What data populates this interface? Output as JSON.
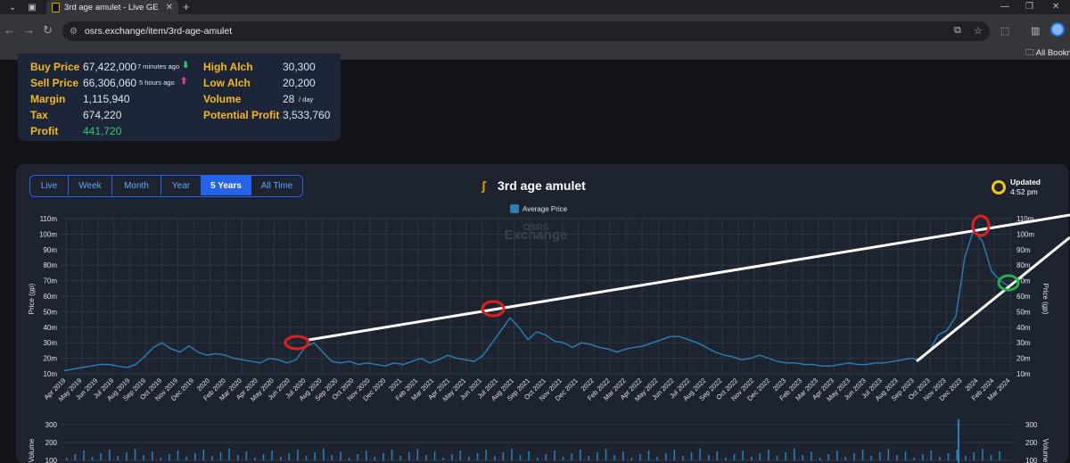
{
  "browser": {
    "tab_title": "3rd age amulet - Live GE Price C",
    "url": "osrs.exchange/item/3rd-age-amulet",
    "bookmarks_label": "All Bookm"
  },
  "stats": {
    "buy_price_label": "Buy Price",
    "buy_price": "67,422,000",
    "buy_time": "7 minutes ago",
    "sell_price_label": "Sell Price",
    "sell_price": "66,306,060",
    "sell_time": "5 hours ago",
    "margin_label": "Margin",
    "margin": "1,115,940",
    "tax_label": "Tax",
    "tax": "674,220",
    "profit_label": "Profit",
    "profit": "441,720",
    "high_alch_label": "High Alch",
    "high_alch": "30,300",
    "low_alch_label": "Low Alch",
    "low_alch": "20,200",
    "volume_label": "Volume",
    "volume": "28",
    "volume_unit": "/ day",
    "potential_profit_label": "Potential Profit",
    "potential_profit": "3,533,760"
  },
  "ranges": [
    {
      "label": "Live",
      "active": false
    },
    {
      "label": "Week",
      "active": false
    },
    {
      "label": "Month",
      "active": false
    },
    {
      "label": "Year",
      "active": false
    },
    {
      "label": "5 Years",
      "active": true
    },
    {
      "label": "All Time",
      "active": false
    }
  ],
  "chart_header": {
    "title": "3rd age amulet",
    "updated_label": "Updated",
    "updated_time": "4:52 pm",
    "watermark_top": "OSRS",
    "watermark_bottom": "Exchange"
  },
  "colors": {
    "line": "#2a7fb8",
    "accent": "#2563eb",
    "gold": "#f5b81b",
    "profit": "#2ecc71",
    "annotation_red": "#e02020",
    "annotation_green": "#22b14c",
    "annotation_line": "#ffffff"
  },
  "chart_data": [
    {
      "type": "line",
      "title": "3rd age amulet",
      "ylabel": "Price (gp)",
      "series": [
        {
          "name": "Average Price",
          "values": [
            12,
            13,
            14,
            15,
            16,
            16,
            15,
            14,
            16,
            21,
            27,
            30,
            26,
            24,
            28,
            24,
            22,
            23,
            22,
            20,
            19,
            18,
            17,
            20,
            19,
            17,
            19,
            27,
            30,
            24,
            18,
            17,
            18,
            16,
            17,
            16,
            15,
            17,
            16,
            18,
            20,
            17,
            19,
            22,
            20,
            19,
            18,
            22,
            30,
            38,
            46,
            40,
            32,
            37,
            35,
            31,
            30,
            27,
            30,
            29,
            27,
            26,
            24,
            26,
            27,
            28,
            30,
            32,
            34,
            34,
            32,
            30,
            27,
            24,
            22,
            21,
            19,
            20,
            22,
            20,
            18,
            17,
            17,
            16,
            16,
            15,
            15,
            16,
            17,
            16,
            16,
            17,
            17,
            18,
            19,
            20,
            19,
            24,
            35,
            38,
            47,
            85,
            103,
            95,
            76,
            70,
            66
          ]
        }
      ],
      "x_tick_labels": [
        "Apr 2019",
        "May 2019",
        "Jun 2019",
        "Jul 2019",
        "Aug 2019",
        "Sep 2019",
        "Oct 2019",
        "Nov 2019",
        "Dec 2019",
        "2020",
        "Feb 2020",
        "Mar 2020",
        "Apr 2020",
        "May 2020",
        "Jun 2020",
        "Jul 2020",
        "Aug 2020",
        "Sep 2020",
        "Oct 2020",
        "Nov 2020",
        "Dec 2020",
        "2021",
        "Feb 2021",
        "Mar 2021",
        "Apr 2021",
        "May 2021",
        "Jun 2021",
        "Jul 2021",
        "Aug 2021",
        "Sep 2021",
        "Oct 2021",
        "Nov 2021",
        "Dec 2021",
        "2022",
        "Feb 2022",
        "Mar 2022",
        "Apr 2022",
        "May 2022",
        "Jun 2022",
        "Jul 2022",
        "Aug 2022",
        "Sep 2022",
        "Oct 2022",
        "Nov 2022",
        "Dec 2022",
        "2023",
        "Feb 2023",
        "Mar 2023",
        "Apr 2023",
        "May 2023",
        "Jun 2023",
        "Jul 2023",
        "Aug 2023",
        "Sep 2023",
        "Oct 2023",
        "Nov 2023",
        "Dec 2023",
        "2024",
        "Feb 2024",
        "Mar 2024"
      ],
      "y_tick_labels": [
        "110m",
        "100m",
        "90m",
        "80m",
        "70m",
        "60m",
        "50m",
        "40m",
        "30m",
        "20m",
        "10m"
      ],
      "ylim": [
        10,
        110
      ],
      "y_unit": "m",
      "grid": true,
      "legend": "top-center"
    },
    {
      "type": "bar",
      "title": "",
      "ylabel": "Volume",
      "y_tick_labels": [
        "300",
        "200",
        "100"
      ],
      "grid": true
    }
  ]
}
